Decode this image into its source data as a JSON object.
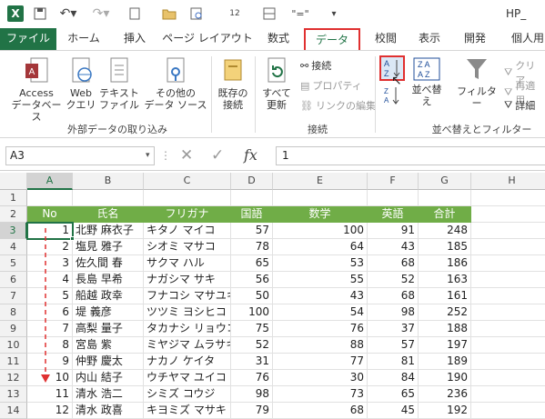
{
  "title": {
    "app_icon": "X",
    "window_title": "HP_"
  },
  "quick_access": {
    "save": "save-icon",
    "undo": "undo-icon",
    "redo": "redo-icon",
    "open": "open-icon",
    "new": "new-icon",
    "font_size_label": "12",
    "equals_label": "\"=\""
  },
  "tabs": {
    "file": "ファイル",
    "home": "ホーム",
    "insert": "挿入",
    "page_layout": "ページ レイアウト",
    "formulas": "数式",
    "data": "データ",
    "review": "校閲",
    "view": "表示",
    "developer": "開発",
    "personal": "個人用"
  },
  "ribbon": {
    "access": "Access\nデータベース",
    "web": "Web\nクエリ",
    "text_file": "テキスト\nファイル",
    "other_sources": "その他の\nデータ ソース",
    "existing": "既存の\n接続",
    "refresh_all": "すべて\n更新",
    "connections": "接続",
    "properties": "プロパティ",
    "edit_links": "リンクの編集",
    "sort": "並べ替え",
    "filter": "フィルター",
    "clear": "クリア",
    "reapply": "再適用",
    "advanced": "詳細",
    "group_external": "外部データの取り込み",
    "group_connections": "接続",
    "group_sort_filter": "並べ替えとフィルター"
  },
  "formula_bar": {
    "name_box": "A3",
    "value": "1",
    "fx": "fx"
  },
  "sheet": {
    "columns": [
      "A",
      "B",
      "C",
      "D",
      "E",
      "F",
      "G",
      "H"
    ],
    "rows": [
      "1",
      "2",
      "3",
      "4",
      "5",
      "6",
      "7",
      "8",
      "9",
      "10",
      "11",
      "12",
      "13",
      "14"
    ],
    "headers": [
      "No",
      "氏名",
      "フリガナ",
      "国語",
      "数学",
      "英語",
      "合計"
    ],
    "records": [
      [
        "1",
        "北野 麻衣子",
        "キタノ マイコ",
        "57",
        "100",
        "91",
        "248"
      ],
      [
        "2",
        "塩見 雅子",
        "シオミ マサコ",
        "78",
        "64",
        "43",
        "185"
      ],
      [
        "3",
        "佐久間 春",
        "サクマ ハル",
        "65",
        "53",
        "68",
        "186"
      ],
      [
        "4",
        "長島 早希",
        "ナガシマ サキ",
        "56",
        "55",
        "52",
        "163"
      ],
      [
        "5",
        "船越 政幸",
        "フナコシ マサユキ",
        "50",
        "43",
        "68",
        "161"
      ],
      [
        "6",
        "堤 義彦",
        "ツツミ ヨシヒコ",
        "100",
        "54",
        "98",
        "252"
      ],
      [
        "7",
        "高梨 量子",
        "タカナシ リョウコ",
        "75",
        "76",
        "37",
        "188"
      ],
      [
        "8",
        "宮島 紫",
        "ミヤジマ ムラサキ",
        "52",
        "88",
        "57",
        "197"
      ],
      [
        "9",
        "仲野 慶太",
        "ナカノ ケイタ",
        "31",
        "77",
        "81",
        "189"
      ],
      [
        "10",
        "内山 結子",
        "ウチヤマ ユイコ",
        "76",
        "30",
        "84",
        "190"
      ],
      [
        "11",
        "清水 浩二",
        "シミズ コウジ",
        "98",
        "73",
        "65",
        "236"
      ],
      [
        "12",
        "清水 政喜",
        "キヨミズ マサキ",
        "79",
        "68",
        "45",
        "192"
      ]
    ]
  },
  "colors": {
    "accent": "#217346",
    "header_fill": "#70ad47",
    "highlight": "#e03030"
  }
}
